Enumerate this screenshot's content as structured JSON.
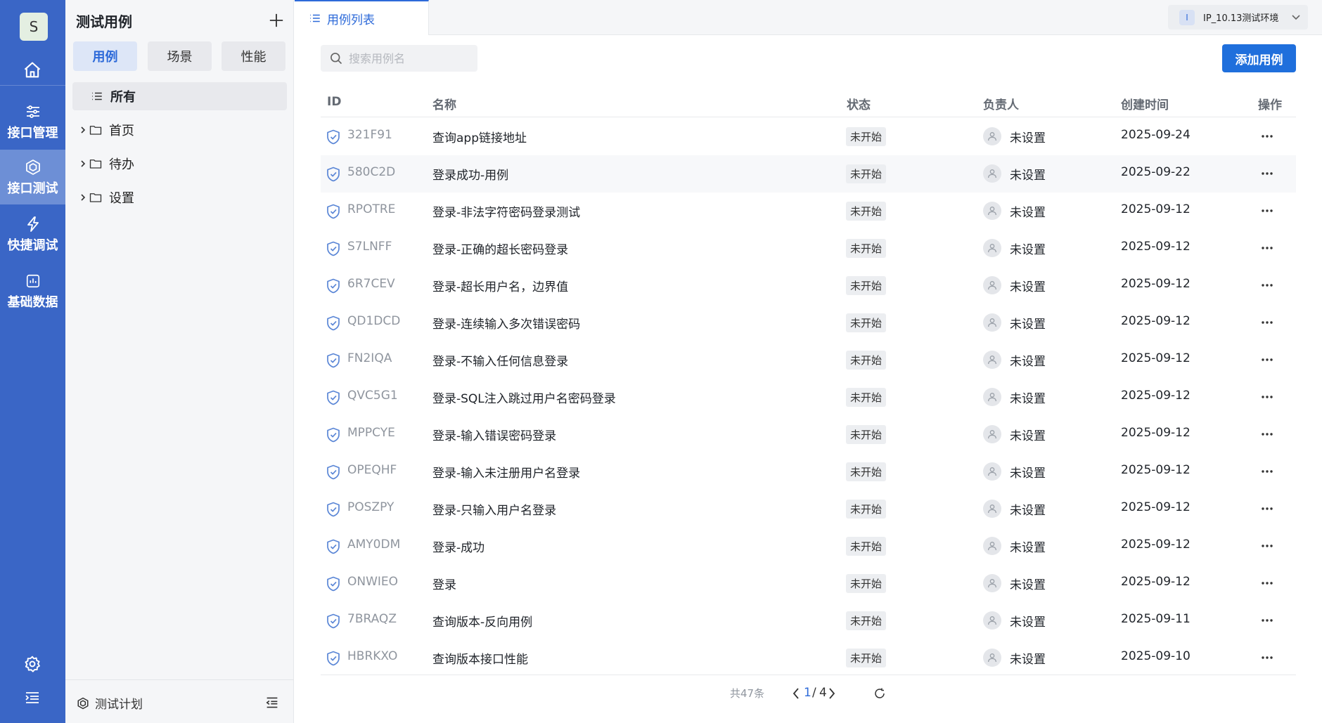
{
  "rail": {
    "avatar_letter": "S",
    "items": [
      {
        "label": "接口管理",
        "icon": "sliders-icon"
      },
      {
        "label": "接口测试",
        "icon": "cube-icon"
      },
      {
        "label": "快捷调试",
        "icon": "lightning-icon"
      },
      {
        "label": "基础数据",
        "icon": "data-chart-icon"
      }
    ],
    "active_item": "接口测试"
  },
  "panel": {
    "title": "测试用例",
    "segments": [
      "用例",
      "场景",
      "性能"
    ],
    "active_segment": "用例",
    "tree_all": "所有",
    "tree_nodes": [
      "首页",
      "待办",
      "设置"
    ],
    "footer_plan": "测试计划"
  },
  "topbar": {
    "tab_label": "用例列表",
    "env_badge": "I",
    "env_label": "IP_10.13测试环境"
  },
  "search": {
    "placeholder": "搜索用例名"
  },
  "add_button": "添加用例",
  "table": {
    "headers": {
      "id": "ID",
      "name": "名称",
      "status": "状态",
      "owner": "负责人",
      "created": "创建时间",
      "actions": "操作"
    },
    "rows": [
      {
        "id": "321F91",
        "name": "查询app链接地址",
        "status": "未开始",
        "owner": "未设置",
        "created": "2025-09-24"
      },
      {
        "id": "580C2D",
        "name": "登录成功-用例",
        "status": "未开始",
        "owner": "未设置",
        "created": "2025-09-22"
      },
      {
        "id": "RPOTRE",
        "name": "登录-非法字符密码登录测试",
        "status": "未开始",
        "owner": "未设置",
        "created": "2025-09-12"
      },
      {
        "id": "S7LNFF",
        "name": "登录-正确的超长密码登录",
        "status": "未开始",
        "owner": "未设置",
        "created": "2025-09-12"
      },
      {
        "id": "6R7CEV",
        "name": "登录-超长用户名，边界值",
        "status": "未开始",
        "owner": "未设置",
        "created": "2025-09-12"
      },
      {
        "id": "QD1DCD",
        "name": "登录-连续输入多次错误密码",
        "status": "未开始",
        "owner": "未设置",
        "created": "2025-09-12"
      },
      {
        "id": "FN2IQA",
        "name": "登录-不输入任何信息登录",
        "status": "未开始",
        "owner": "未设置",
        "created": "2025-09-12"
      },
      {
        "id": "QVC5G1",
        "name": "登录-SQL注入跳过用户名密码登录",
        "status": "未开始",
        "owner": "未设置",
        "created": "2025-09-12"
      },
      {
        "id": "MPPCYE",
        "name": "登录-输入错误密码登录",
        "status": "未开始",
        "owner": "未设置",
        "created": "2025-09-12"
      },
      {
        "id": "OPEQHF",
        "name": "登录-输入未注册用户名登录",
        "status": "未开始",
        "owner": "未设置",
        "created": "2025-09-12"
      },
      {
        "id": "POSZPY",
        "name": "登录-只输入用户名登录",
        "status": "未开始",
        "owner": "未设置",
        "created": "2025-09-12"
      },
      {
        "id": "AMY0DM",
        "name": "登录-成功",
        "status": "未开始",
        "owner": "未设置",
        "created": "2025-09-12"
      },
      {
        "id": "ONWIEO",
        "name": "登录",
        "status": "未开始",
        "owner": "未设置",
        "created": "2025-09-12"
      },
      {
        "id": "7BRAQZ",
        "name": "查询版本-反向用例",
        "status": "未开始",
        "owner": "未设置",
        "created": "2025-09-11"
      },
      {
        "id": "HBRKXO",
        "name": "查询版本接口性能",
        "status": "未开始",
        "owner": "未设置",
        "created": "2025-09-10"
      }
    ]
  },
  "pagination": {
    "total_text": "共47条",
    "current": "1",
    "separator": "/",
    "total_pages": "4"
  },
  "colors": {
    "rail": "#3a66c6",
    "rail_active": "#6d8fd6",
    "primary": "#1f6fdc",
    "shield": "#5a86d6"
  }
}
